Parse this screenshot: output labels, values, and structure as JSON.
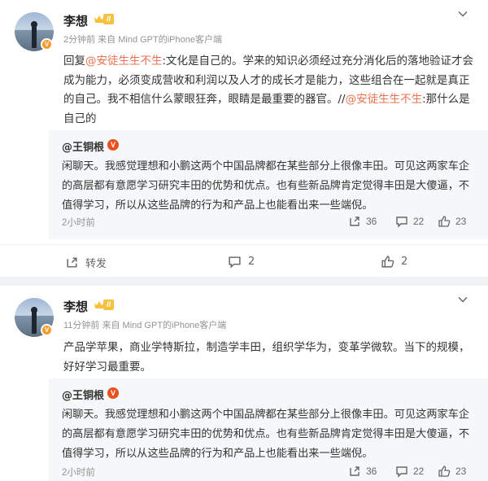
{
  "posts": [
    {
      "author": "李想",
      "level": "II",
      "meta": "2分钟前 来自 Mind GPT的iPhone客户端",
      "reply_prefix": "回复",
      "mention1": "@安徒生生不生",
      "text_a": ":文化是自己的。学来的知识必须经过充分消化后的落地验证才会成为能力，必须变成营收和利润以及人才的成长才是能力，这些组合在一起就是真正的自己。我不相信什么蒙眼狂奔，眼睛是最重要的器官。//",
      "mention2": "@安徒生生不生",
      "text_b": ":那什么是自己的",
      "repost": {
        "author": "@王铜根",
        "text": "闲聊天。我感觉理想和小鹏这两个中国品牌都在某些部分上很像丰田。可见这两家车企的高层都有意愿学习研究丰田的优势和优点。也有些新品牌肯定觉得丰田是大傻逼，不值得学习，所以从这些品牌的行为和产品上也能看出来一些端倪。",
        "time": "2小时前",
        "reposts": "36",
        "comments": "22",
        "likes": "23"
      },
      "actions": {
        "share_label": "转发",
        "comments": "2",
        "likes": "2"
      }
    },
    {
      "author": "李想",
      "level": "II",
      "meta": "11分钟前 来自 Mind GPT的iPhone客户端",
      "text": "产品学苹果，商业学特斯拉，制造学丰田，组织学华为，变革学微软。当下的规模，好好学习最重要。",
      "repost": {
        "author": "@王铜根",
        "text": "闲聊天。我感觉理想和小鹏这两个中国品牌都在某些部分上很像丰田。可见这两家车企的高层都有意愿学习研究丰田的优势和优点。也有些新品牌肯定觉得丰田是大傻逼，不值得学习，所以从这些品牌的行为和产品上也能看出来一些端倪。",
        "time": "2小时前",
        "reposts": "36",
        "comments": "22",
        "likes": "23"
      }
    }
  ],
  "colors": {
    "mention": "#eb7350",
    "badge": "#f79a2b",
    "background": "#f1f2f5"
  }
}
